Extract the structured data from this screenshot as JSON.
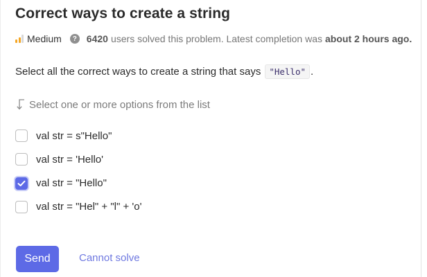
{
  "problem": {
    "title": "Correct ways to create a string",
    "difficulty": "Medium",
    "solved_count": "6420",
    "solved_text": "users solved this problem. Latest completion was",
    "latest_completion": "about 2 hours ago."
  },
  "question": {
    "text": "Select all the correct ways to create a string that says",
    "code": "\"Hello\"",
    "period": "."
  },
  "hint": "Select one or more options from the list",
  "options": [
    {
      "label": "val str = s\"Hello\"",
      "checked": false
    },
    {
      "label": "val str = 'Hello'",
      "checked": false
    },
    {
      "label": "val str = \"Hello\"",
      "checked": true
    },
    {
      "label": "val str = \"Hel\" + \"l\" + 'o'",
      "checked": false
    }
  ],
  "actions": {
    "send_label": "Send",
    "cannot_solve_label": "Cannot solve"
  },
  "colors": {
    "accent": "#5d6ae6",
    "difficulty_bars": "#f5a623",
    "link": "#6e78e0"
  },
  "icons": {
    "difficulty": "difficulty-bars-icon",
    "help": "question-circle-icon",
    "hint": "arrow-down-return-icon",
    "checkmark": "checkmark-icon"
  }
}
